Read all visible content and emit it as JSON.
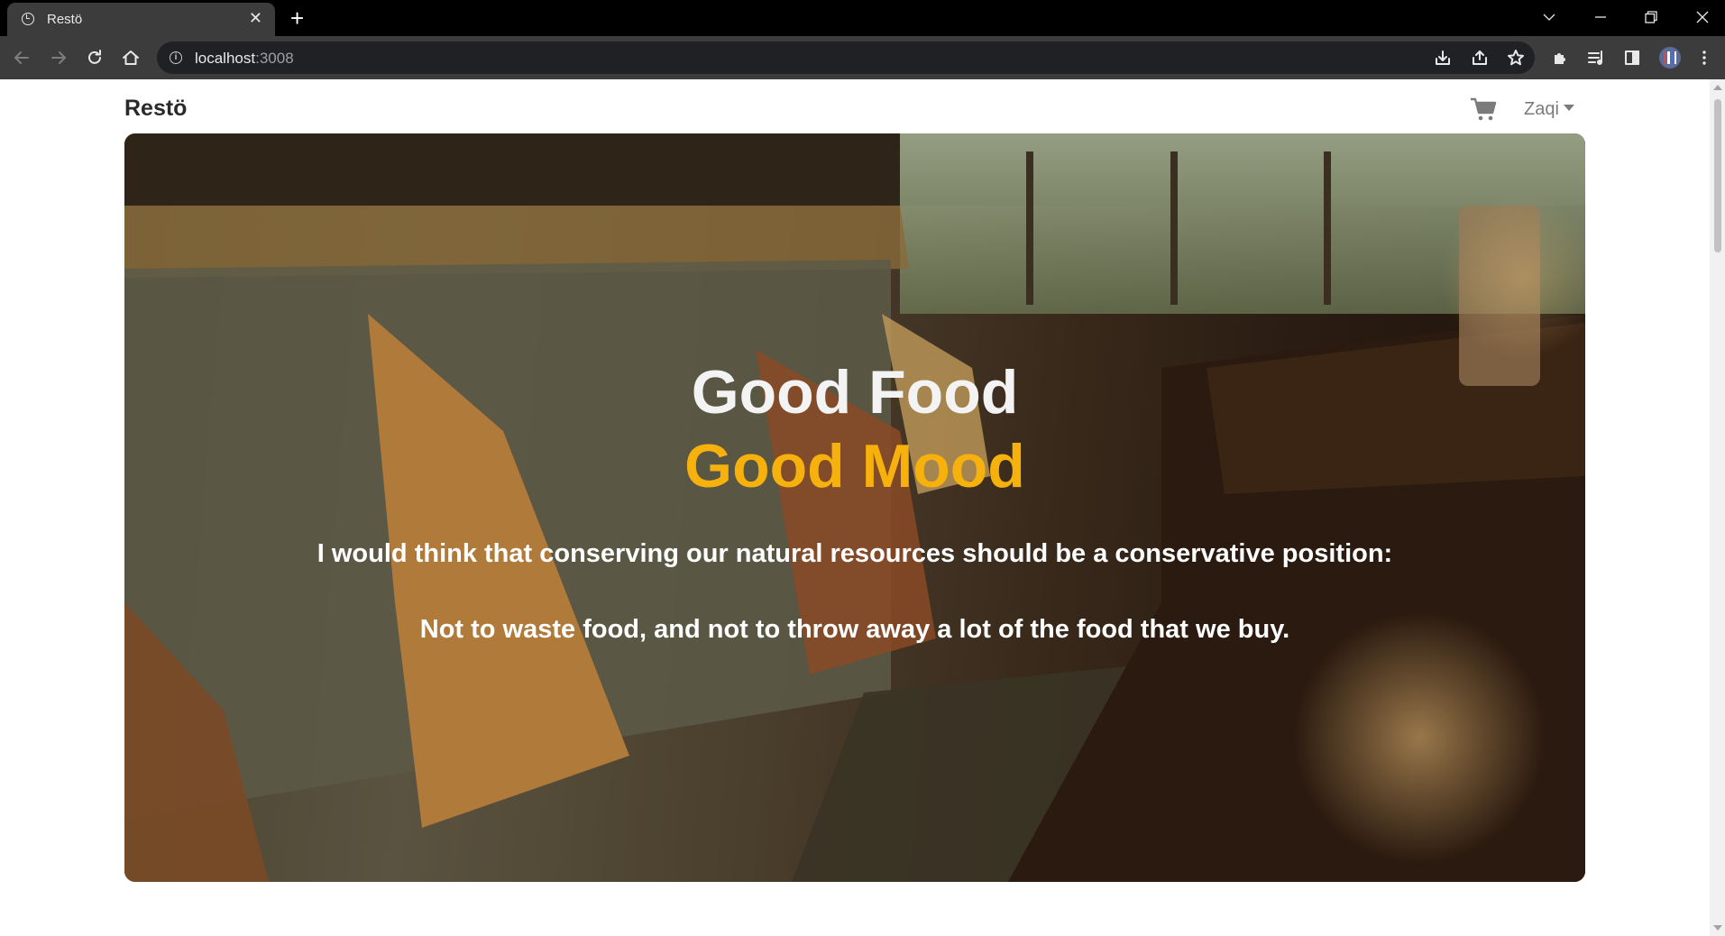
{
  "browser": {
    "tab_title": "Restö",
    "url_host": "localhost",
    "url_port": ":3008"
  },
  "navbar": {
    "brand": "Restö",
    "user_name": "Zaqi"
  },
  "hero": {
    "title_line1": "Good Food",
    "title_line2": "Good Mood",
    "quote_line1": "I would think that conserving our natural resources should be a conservative position:",
    "quote_line2": "Not to waste food, and not to throw away a lot of the food that we buy.",
    "accent_color": "#f6b10d"
  },
  "icons": [
    "info-icon",
    "close-icon",
    "plus-icon",
    "chevron-down-icon",
    "minimize-icon",
    "restore-icon",
    "back-arrow-icon",
    "forward-arrow-icon",
    "reload-icon",
    "home-icon",
    "download-icon",
    "share-icon",
    "star-icon",
    "puzzle-icon",
    "media-icon",
    "sidepanel-icon",
    "profile-icon",
    "kebab-menu-icon",
    "cart-icon",
    "caret-down-icon"
  ]
}
